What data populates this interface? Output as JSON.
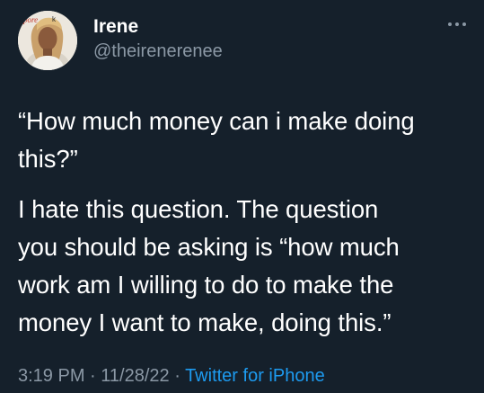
{
  "author": {
    "name": "Irene",
    "handle": "@theirenerenee",
    "avatar_icon": "profile-photo",
    "avatar_text": "pore"
  },
  "more_icon": "more-horizontal-icon",
  "tweet": {
    "paragraphs": [
      "“How much money can i make doing\nthis?”",
      "I hate this question. The question\nyou should be asking is “how much\nwork am I willing to do to make the\nmoney I want to make, doing this.”"
    ]
  },
  "meta": {
    "time": "3:19 PM",
    "separator1": " · ",
    "date": "11/28/22",
    "separator2": " · ",
    "source": "Twitter for iPhone"
  },
  "colors": {
    "background": "#15202b",
    "text": "#ffffff",
    "secondary_text": "#8b98a5",
    "accent": "#1d9bf0"
  }
}
